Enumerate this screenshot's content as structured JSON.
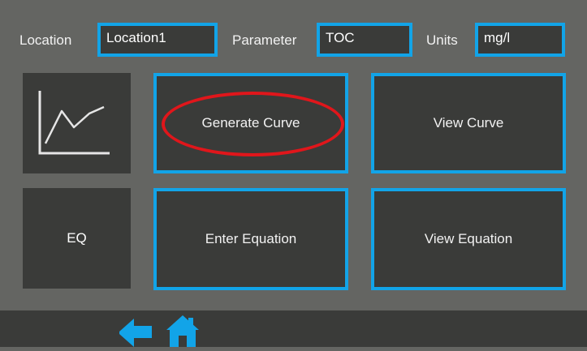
{
  "header": {
    "location_label": "Location",
    "location_value": "Location1",
    "parameter_label": "Parameter",
    "parameter_value": "TOC",
    "units_label": "Units",
    "units_value": "mg/l"
  },
  "tiles": {
    "chart_icon": "line-chart-icon",
    "eq_label": "EQ"
  },
  "buttons": {
    "generate_curve": "Generate Curve",
    "view_curve": "View Curve",
    "enter_equation": "Enter Equation",
    "view_equation": "View Equation"
  },
  "footer": {
    "back_icon": "back-arrow-icon",
    "home_icon": "home-icon"
  },
  "colors": {
    "background": "#646562",
    "panel": "#3a3b39",
    "accent": "#12a4e8",
    "highlight": "#e0161b"
  }
}
